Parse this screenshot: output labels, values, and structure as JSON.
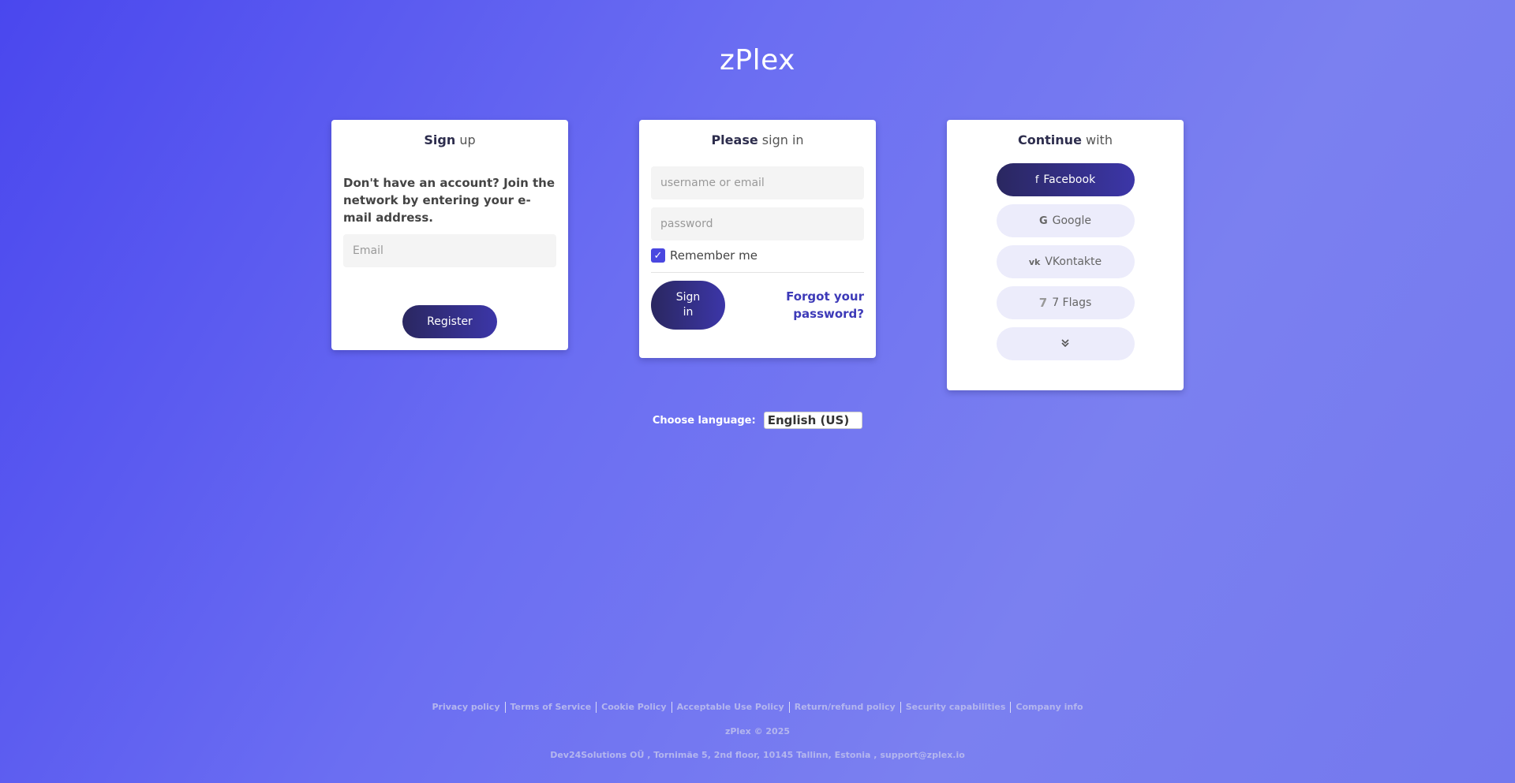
{
  "brand": "zPlex",
  "signup": {
    "title_bold": "Sign",
    "title_rest": "up",
    "text": "Don't have an account? Join the network by entering your e-mail address.",
    "email_placeholder": "Email",
    "register_label": "Register"
  },
  "signin": {
    "title_bold": "Please",
    "title_rest": "sign in",
    "username_placeholder": "username or email",
    "password_placeholder": "password",
    "remember_label": "Remember me",
    "remember_checked": true,
    "signin_label": "Sign in",
    "forgot_label": "Forgot your password?"
  },
  "social": {
    "title_bold": "Continue",
    "title_rest": "with",
    "buttons": [
      {
        "label": "Facebook",
        "icon": "facebook-icon",
        "glyph": "f"
      },
      {
        "label": "Google",
        "icon": "google-icon",
        "glyph": "G"
      },
      {
        "label": "VKontakte",
        "icon": "vk-icon",
        "glyph": "vk"
      },
      {
        "label": "7 Flags",
        "icon": "7flags-icon",
        "glyph": "7"
      }
    ],
    "more_icon": "chevron-double-down-icon"
  },
  "language": {
    "label": "Choose language:",
    "selected": "English (US)"
  },
  "footer": {
    "links": [
      "Privacy policy",
      "Terms of Service",
      "Cookie Policy",
      "Acceptable Use Policy",
      "Return/refund policy",
      "Security capabilities",
      "Company info"
    ],
    "copyright": "zPlex © 2025",
    "address": "Dev24Solutions OÜ , Tornimäe 5, 2nd floor, 10145 Tallinn, Estonia , support@zplex.io"
  },
  "colors": {
    "accent": "#4a47e0",
    "button_dark": "#2a2760",
    "link": "#3d3ab8"
  }
}
